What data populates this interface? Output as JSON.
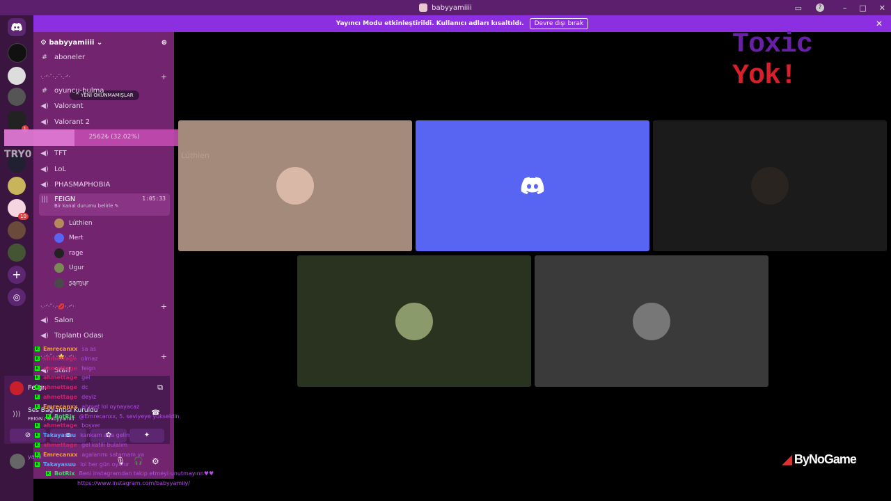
{
  "window": {
    "title": "babyyamiiii",
    "controls": [
      "cast",
      "?",
      "–",
      "□",
      "✕"
    ]
  },
  "banner": {
    "text": "Yayıncı Modu etkinleştirildi. Kullanıcı adları kısaltıldı.",
    "button": "Devre dışı bırak",
    "close": "✕"
  },
  "server": {
    "name": "babyyamiiii",
    "invite_icon": "person-add-icon"
  },
  "unread_pill": "^ YENİ OKUNMAMIŞLAR",
  "channels": [
    {
      "icon": "#",
      "name": "aboneler"
    },
    {
      "icon": "sep",
      "name": "·.·ᐟ·¨·.·¨·.·ᐟ·"
    },
    {
      "icon": "#",
      "name": "oyuncu-bulma"
    },
    {
      "icon": "🔊",
      "name": "Valorant"
    },
    {
      "icon": "🔊",
      "name": "Valorant 2"
    },
    {
      "icon": "🔊",
      "name": "TFT"
    },
    {
      "icon": "🔊",
      "name": "LoL"
    },
    {
      "icon": "🔊",
      "name": "PHASMAPHOBIA"
    }
  ],
  "active_channel": {
    "name": "FEIGN",
    "timer": "1:05:33",
    "status": "Bir kanal durumu belirle"
  },
  "members": [
    {
      "name": "Lúthien",
      "color": "#b48a5a"
    },
    {
      "name": "Mert",
      "color": "#5865f2"
    },
    {
      "name": "rage",
      "color": "#222"
    },
    {
      "name": "Ugur",
      "color": "#7a8a55"
    },
    {
      "name": "ʂąɱųr",
      "color": "#4a4a4a"
    }
  ],
  "lower_channels": [
    {
      "icon": "sep",
      "name": "·.·ᐟ·¨·.·💋·.·ᐟ·"
    },
    {
      "icon": "🔊",
      "name": "Salon"
    },
    {
      "icon": "🔊",
      "name": "Toplantı Odası"
    },
    {
      "icon": "sep",
      "name": "·.·ᐟ·¨·.·⭐·.·ᐟ·"
    },
    {
      "icon": "🔊",
      "name": "Staff"
    }
  ],
  "overlay": {
    "text": "2562₺ (32.02%)",
    "progress": 0.3202,
    "side_label": "TRY0",
    "ghost_label": "Lúthien"
  },
  "voice": {
    "status": "Ses Bağlantısı Kuruldu",
    "location": "FEIGN / babyyamiii",
    "stream_label": "Feign"
  },
  "user": {
    "name": "yami"
  },
  "chat": [
    {
      "user": "Emrecanxx",
      "msg": "sa as",
      "ucolor": "#f0a040"
    },
    {
      "user": "shmettage",
      "msg": "olmaz",
      "ucolor": "#c8236b"
    },
    {
      "user": "ahmettage",
      "msg": "feign",
      "ucolor": "#c8236b"
    },
    {
      "user": "ahmettage",
      "msg": "gel",
      "ucolor": "#c8236b"
    },
    {
      "user": "ahmettage",
      "msg": "dc",
      "ucolor": "#c8236b"
    },
    {
      "user": "ahmettage",
      "msg": "deyiz",
      "ucolor": "#c8236b"
    },
    {
      "user": "Emrecanxx",
      "msg": "ahmet lol oynayacaz",
      "ucolor": "#f0a040"
    },
    {
      "user": "BotRix",
      "msg": "@Emrecanxx, 5. seviyeye yükseldin",
      "ucolor": "#43d36b"
    },
    {
      "user": "ahmettage",
      "msg": "boşver",
      "ucolor": "#c8236b"
    },
    {
      "user": "Takayasuu",
      "msg": "kankam aga gelin",
      "ucolor": "#5aa7ff"
    },
    {
      "user": "ahmettage",
      "msg": "gel katili bulalım",
      "ucolor": "#c8236b"
    },
    {
      "user": "Emrecanxx",
      "msg": "agalarımı satamam ya",
      "ucolor": "#f0a040"
    },
    {
      "user": "Takayasuu",
      "msg": "lol her gün oyanır",
      "ucolor": "#5aa7ff"
    },
    {
      "user": "BotRix",
      "msg": "Beni instagramdan takip etmeyi unutmayınn♥♥",
      "ucolor": "#43d36b"
    }
  ],
  "chat_link": "https://www.instagram.com/babyyamiiy/",
  "overlay_title": {
    "part1": "Toxic",
    "part2": "Yok!",
    "color1": "#6a1fa8",
    "color2": "#d81f2b"
  },
  "sponsor": "ByNoGame"
}
